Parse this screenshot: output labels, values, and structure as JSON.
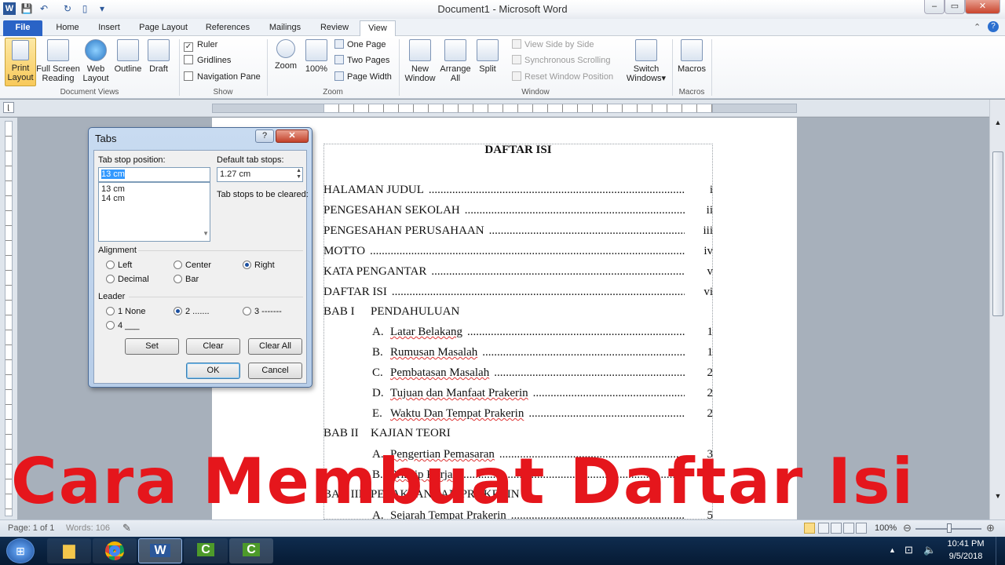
{
  "window": {
    "title": "Document1 - Microsoft Word",
    "min_label": "–",
    "max_label": "▭",
    "close_label": "✕"
  },
  "tabs": [
    "File",
    "Home",
    "Insert",
    "Page Layout",
    "References",
    "Mailings",
    "Review",
    "View"
  ],
  "ribbon": {
    "document_views": {
      "label": "Document Views",
      "buttons": [
        "Print Layout",
        "Full Screen Reading",
        "Web Layout",
        "Outline",
        "Draft"
      ]
    },
    "show": {
      "label": "Show",
      "items": [
        {
          "label": "Ruler",
          "checked": true
        },
        {
          "label": "Gridlines",
          "checked": false
        },
        {
          "label": "Navigation Pane",
          "checked": false
        }
      ]
    },
    "zoom": {
      "label": "Zoom",
      "zoom_btn": "Zoom",
      "pct_btn": "100%",
      "one_page": "One Page",
      "two_pages": "Two Pages",
      "page_width": "Page Width"
    },
    "window": {
      "label": "Window",
      "new_window": "New Window",
      "arrange_all": "Arrange All",
      "split": "Split",
      "side_by_side": "View Side by Side",
      "sync_scroll": "Synchronous Scrolling",
      "reset_pos": "Reset Window Position",
      "switch": "Switch Windows"
    },
    "macros": {
      "label": "Macros",
      "btn": "Macros"
    }
  },
  "dialog": {
    "title": "Tabs",
    "help": "?",
    "close": "✕",
    "tab_stop_label": "Tab stop position:",
    "tab_stop_value": "13 cm",
    "tab_stop_list": [
      "13 cm",
      "14 cm"
    ],
    "default_label": "Default tab stops:",
    "default_value": "1.27 cm",
    "to_clear_label": "Tab stops to be cleared:",
    "alignment_label": "Alignment",
    "alignment": [
      "Left",
      "Center",
      "Right",
      "Decimal",
      "Bar"
    ],
    "alignment_selected": "Right",
    "leader_label": "Leader",
    "leader": [
      "1 None",
      "2 .......",
      "3 -------",
      "4 ___"
    ],
    "leader_selected": "2 .......",
    "buttons": {
      "set": "Set",
      "clear": "Clear",
      "clear_all": "Clear All",
      "ok": "OK",
      "cancel": "Cancel"
    }
  },
  "document": {
    "heading": "DAFTAR ISI",
    "entries": [
      {
        "text": "HALAMAN JUDUL",
        "page": "i"
      },
      {
        "text": "PENGESAHAN SEKOLAH",
        "page": "ii"
      },
      {
        "text": "PENGESAHAN PERUSAHAAN",
        "page": "iii"
      },
      {
        "text": "MOTTO",
        "page": "iv"
      },
      {
        "text": "KATA PENGANTAR",
        "page": "v"
      },
      {
        "text": "DAFTAR ISI",
        "page": "vi"
      }
    ],
    "bab1": {
      "num": "BAB I",
      "title": "PENDAHULUAN"
    },
    "bab1_items": [
      {
        "letter": "A.",
        "text": "Latar Belakang",
        "page": "1"
      },
      {
        "letter": "B.",
        "text": "Rumusan Masalah",
        "page": "1"
      },
      {
        "letter": "C.",
        "text": "Pembatasan Masalah",
        "page": "2"
      },
      {
        "letter": "D.",
        "text": "Tujuan dan Manfaat Prakerin",
        "page": "2"
      },
      {
        "letter": "E.",
        "text": "Waktu Dan Tempat Prakerin",
        "page": "2"
      }
    ],
    "bab2": {
      "num": "BAB II",
      "title": "KAJIAN TEORI"
    },
    "bab2_items": [
      {
        "letter": "A.",
        "text": "Pengertian Pemasaran",
        "page": "3"
      },
      {
        "letter": "B.",
        "text": "Prinsip Kerja",
        "page": "3"
      }
    ],
    "bab3": {
      "num": "BAB III",
      "title": "PELAKSANAAN PRAKERIN"
    },
    "bab3_items": [
      {
        "letter": "A.",
        "text": "Sejarah Tempat Prakerin",
        "page": "5"
      }
    ]
  },
  "overlay_text": "Cara Membuat Daftar Isi",
  "status": {
    "page": "Page: 1 of 1",
    "words": "Words: 106",
    "zoom": "100%"
  },
  "taskbar": {
    "time": "10:41 PM",
    "date": "9/5/2018"
  },
  "colors": {
    "overlay": "#e5161c",
    "file_tab": "#2a63c6",
    "taskbar": "#0f2c4f"
  }
}
